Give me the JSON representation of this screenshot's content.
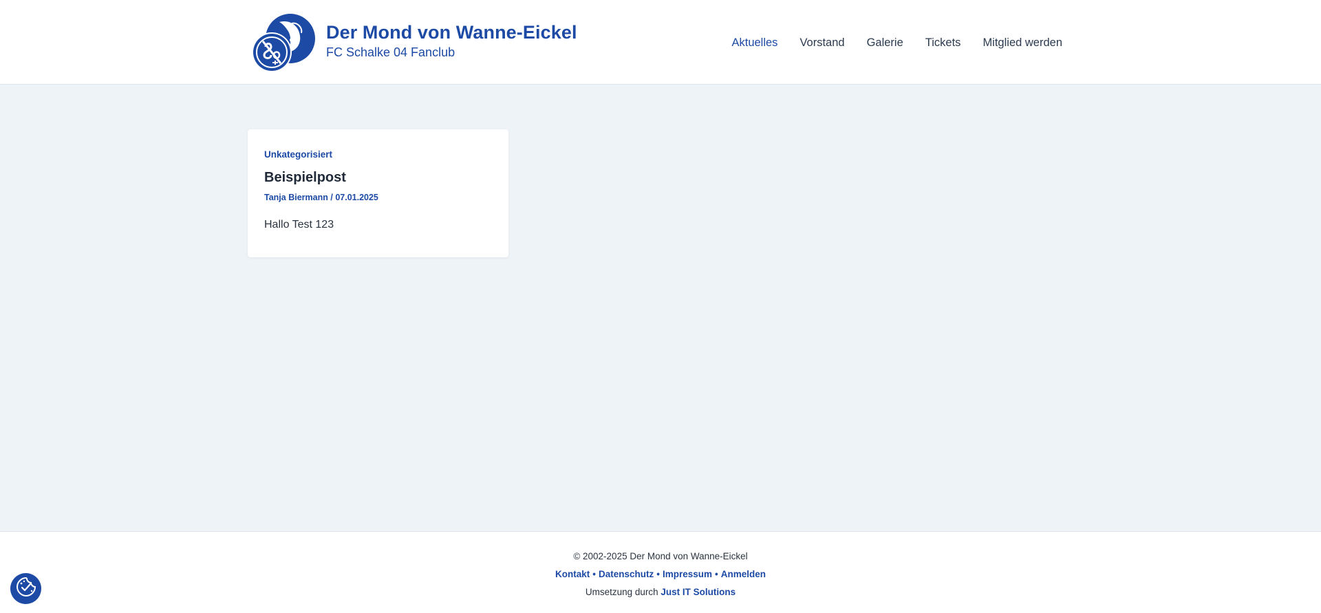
{
  "header": {
    "logo_icon": "schalke-fanclub-logo-icon",
    "title": "Der Mond von Wanne-Eickel",
    "subtitle": "FC Schalke 04 Fanclub",
    "nav": [
      {
        "label": "Aktuelles",
        "active": true
      },
      {
        "label": "Vorstand",
        "active": false
      },
      {
        "label": "Galerie",
        "active": false
      },
      {
        "label": "Tickets",
        "active": false
      },
      {
        "label": "Mitglied werden",
        "active": false
      }
    ]
  },
  "posts": [
    {
      "category": "Unkategorisiert",
      "title": "Beispielpost",
      "author": "Tanja Biermann",
      "date_separator": "/",
      "date": "07.01.2025",
      "excerpt": "Hallo Test 123"
    }
  ],
  "footer": {
    "copyright": "© 2002-2025 Der Mond von Wanne-Eickel",
    "links": [
      "Kontakt",
      "Datenschutz",
      "Impressum",
      "Anmelden"
    ],
    "separator": "•",
    "credit_prefix": "Umsetzung durch",
    "credit_link": "Just IT Solutions"
  },
  "cookie_button": {
    "icon": "cookie-consent-icon"
  },
  "colors": {
    "brand": "#1d4aa5",
    "background": "#eef3f7",
    "surface": "#ffffff",
    "text": "#1f2937"
  }
}
